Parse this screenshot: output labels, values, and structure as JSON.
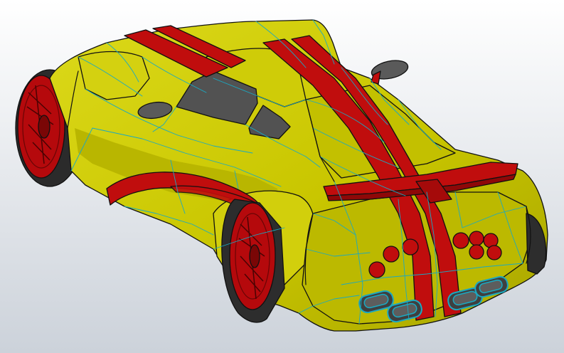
{
  "scene": {
    "colors": {
      "background_top": "#ffffff",
      "background_bottom": "#ccd2da",
      "body_yellow": "#c9c600",
      "body_yellow_light": "#dcd91a",
      "body_yellow_dark": "#a3a000",
      "stripe_red": "#c00d0d",
      "stripe_red_dark": "#8e0808",
      "glass": "#505050",
      "tire": "#2a2a2a",
      "tire_side": "#3a3a3a",
      "rim": "#b5090c",
      "edge_cyan": "#1aa9c2",
      "outline": "#111111"
    },
    "icons": {
      "car": "sports-car-cad-model-icon"
    }
  }
}
